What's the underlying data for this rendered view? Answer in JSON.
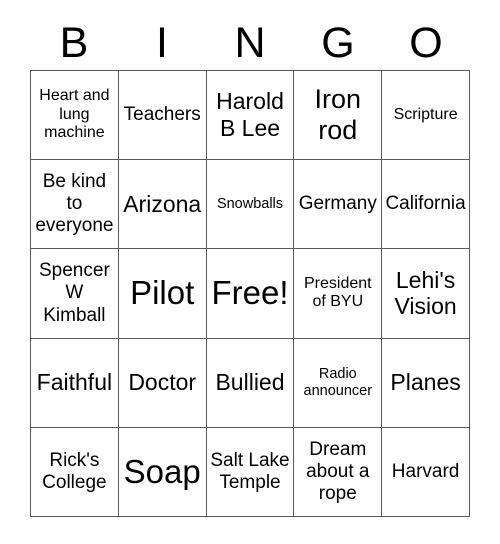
{
  "card": {
    "title": "BINGO",
    "header_letters": [
      "B",
      "I",
      "N",
      "G",
      "O"
    ],
    "border_color": "#555b5e",
    "background_color": "#ffffff",
    "text_color": "#000000",
    "rows": 5,
    "columns": 5,
    "free_space_label": "Free!",
    "cells": [
      [
        {
          "text": "Heart and lung machine",
          "size": "fs-s"
        },
        {
          "text": "Teachers",
          "size": "fs-m"
        },
        {
          "text": "Harold B Lee",
          "size": "fs-l"
        },
        {
          "text": "Iron rod",
          "size": "fs-xl"
        },
        {
          "text": "Scripture",
          "size": "fs-s"
        }
      ],
      [
        {
          "text": "Be kind to everyone",
          "size": "fs-m"
        },
        {
          "text": "Arizona",
          "size": "fs-l"
        },
        {
          "text": "Snowballs",
          "size": "fs-xs"
        },
        {
          "text": "Germany",
          "size": "fs-m"
        },
        {
          "text": "California",
          "size": "fs-m"
        }
      ],
      [
        {
          "text": "Spencer W Kimball",
          "size": "fs-m"
        },
        {
          "text": "Pilot",
          "size": "fs-xxl"
        },
        {
          "text": "Free!",
          "size": "fs-xxl"
        },
        {
          "text": "President of BYU",
          "size": "fs-s"
        },
        {
          "text": "Lehi's Vision",
          "size": "fs-l"
        }
      ],
      [
        {
          "text": "Faithful",
          "size": "fs-l"
        },
        {
          "text": "Doctor",
          "size": "fs-l"
        },
        {
          "text": "Bullied",
          "size": "fs-l"
        },
        {
          "text": "Radio announcer",
          "size": "fs-xs"
        },
        {
          "text": "Planes",
          "size": "fs-l"
        }
      ],
      [
        {
          "text": "Rick's College",
          "size": "fs-m"
        },
        {
          "text": "Soap",
          "size": "fs-xxl"
        },
        {
          "text": "Salt Lake Temple",
          "size": "fs-m"
        },
        {
          "text": "Dream about a rope",
          "size": "fs-m"
        },
        {
          "text": "Harvard",
          "size": "fs-m"
        }
      ]
    ]
  }
}
